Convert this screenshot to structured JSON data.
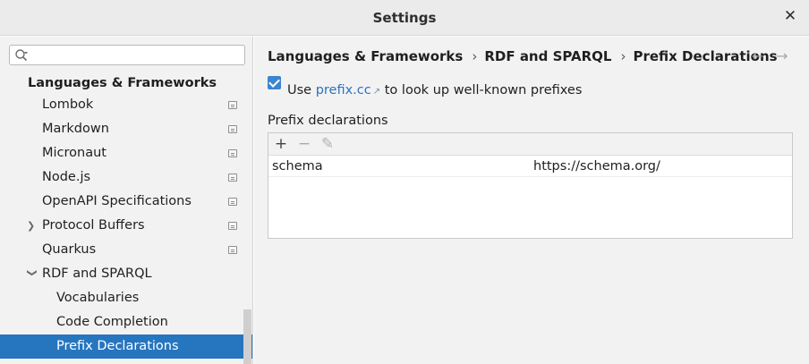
{
  "window": {
    "title": "Settings"
  },
  "search": {
    "value": "",
    "placeholder": ""
  },
  "sidebar": {
    "group": "Languages & Frameworks",
    "items": [
      {
        "label": "Lombok",
        "badge": true
      },
      {
        "label": "Markdown",
        "badge": true
      },
      {
        "label": "Micronaut",
        "badge": true
      },
      {
        "label": "Node.js",
        "badge": true
      },
      {
        "label": "OpenAPI Specifications",
        "badge": true
      },
      {
        "label": "Protocol Buffers",
        "badge": true,
        "expander": "collapsed"
      },
      {
        "label": "Quarkus",
        "badge": true
      },
      {
        "label": "RDF and SPARQL",
        "badge": false,
        "expander": "expanded"
      },
      {
        "label": "Vocabularies",
        "level": 2
      },
      {
        "label": "Code Completion",
        "level": 2
      },
      {
        "label": "Prefix Declarations",
        "level": 2,
        "selected": true
      }
    ]
  },
  "breadcrumb": [
    "Languages & Frameworks",
    "RDF and SPARQL",
    "Prefix Declarations"
  ],
  "option": {
    "checked": true,
    "prefix_text": "Use",
    "link_text": "prefix.cc",
    "suffix_text": "to look up well-known prefixes"
  },
  "prefix_table": {
    "label": "Prefix declarations",
    "rows": [
      {
        "prefix": "schema",
        "uri": "https://schema.org/"
      }
    ]
  },
  "colors": {
    "selection": "#2675bf",
    "link": "#2d72c0",
    "checkbox": "#3a86d0"
  }
}
